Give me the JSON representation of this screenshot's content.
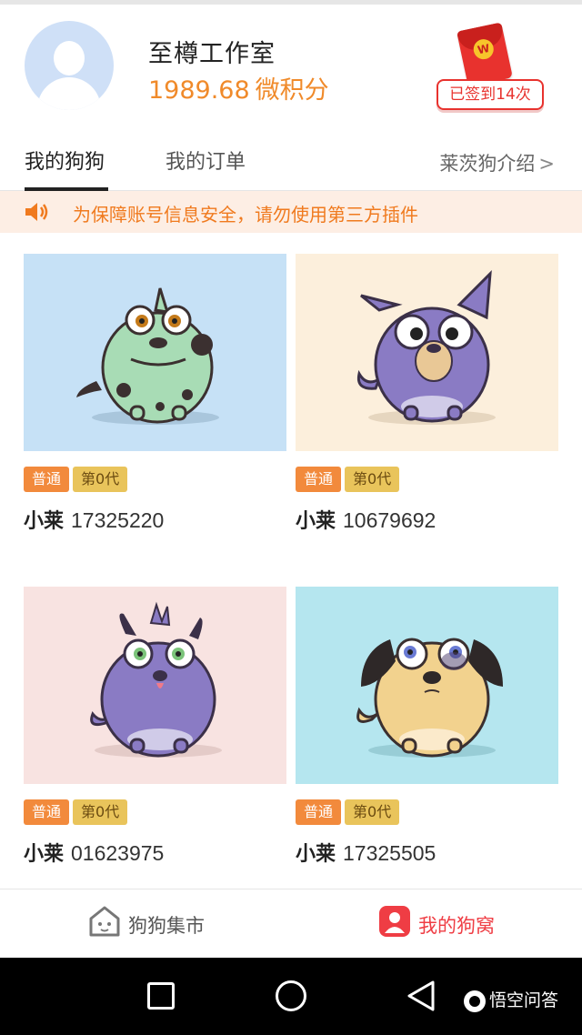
{
  "profile": {
    "name": "至樽工作室",
    "points_value": "1989.68",
    "points_unit": "微积分",
    "signin_label": "已签到14次",
    "redpacket_mark": "W"
  },
  "tabs": {
    "items": [
      {
        "label": "我的狗狗",
        "active": true
      },
      {
        "label": "我的订单",
        "active": false
      }
    ],
    "intro_link": "莱茨狗介绍",
    "intro_chevron": ">"
  },
  "notice": {
    "text": "为保障账号信息安全，请勿使用第三方插件"
  },
  "colors": {
    "accent_orange": "#f08a2a",
    "notice_bg": "#fdeee4",
    "level_badge": "#f28a3c",
    "gen_badge": "#e9c45b",
    "active_nav": "#ef3d44"
  },
  "dogs": [
    {
      "level": "普通",
      "generation": "第0代",
      "name": "小莱",
      "id": "17325220",
      "bg": "#c6e1f6",
      "icon": "green-spotted-dog-icon"
    },
    {
      "level": "普通",
      "generation": "第0代",
      "name": "小莱",
      "id": "10679692",
      "bg": "#fcefdc",
      "icon": "purple-big-ear-dog-icon"
    },
    {
      "level": "普通",
      "generation": "第0代",
      "name": "小莱",
      "id": "01623975",
      "bg": "#f8e3e1",
      "icon": "purple-mohawk-dog-icon"
    },
    {
      "level": "普通",
      "generation": "第0代",
      "name": "小莱",
      "id": "17325505",
      "bg": "#b5e6ef",
      "icon": "tan-floppy-ear-dog-icon"
    }
  ],
  "bottom_nav": {
    "market": "狗狗集市",
    "mine": "我的狗窝"
  },
  "system": {
    "watermark": "悟空问答"
  }
}
